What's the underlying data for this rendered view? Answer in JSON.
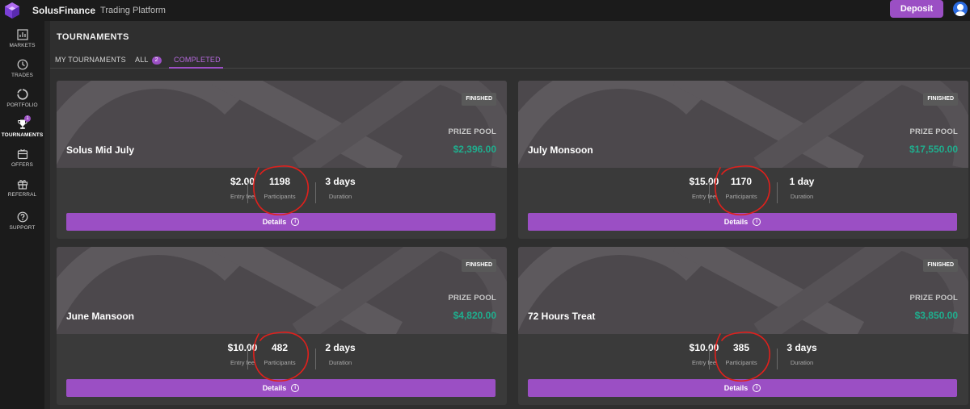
{
  "app": {
    "name": "SolusFinance",
    "subtitle": "Trading Platform",
    "deposit_label": "Deposit"
  },
  "sidebar": {
    "items": [
      {
        "label": "MARKETS",
        "icon": "chart-icon"
      },
      {
        "label": "TRADES",
        "icon": "clock-icon"
      },
      {
        "label": "PORTFOLIO",
        "icon": "portfolio-icon"
      },
      {
        "label": "TOURNAMENTS",
        "icon": "trophy-icon",
        "badge": "1"
      },
      {
        "label": "OFFERS",
        "icon": "offers-icon"
      },
      {
        "label": "REFERRAL",
        "icon": "gift-icon"
      },
      {
        "label": "SUPPORT",
        "icon": "help-icon"
      }
    ]
  },
  "page": {
    "title": "TOURNAMENTS",
    "tabs": [
      {
        "label": "MY TOURNAMENTS"
      },
      {
        "label": "ALL",
        "count": "2"
      },
      {
        "label": "COMPLETED"
      }
    ]
  },
  "labels": {
    "finished": "FINISHED",
    "prize_pool": "PRIZE POOL",
    "entry_fee": "Entry fee",
    "participants": "Participants",
    "duration": "Duration",
    "details": "Details",
    "info": "i"
  },
  "tournaments": [
    {
      "name": "Solus Mid July",
      "prize": "$2,396.00",
      "entry_fee": "$2.00",
      "participants": "1198",
      "duration": "3 days"
    },
    {
      "name": "July Monsoon",
      "prize": "$17,550.00",
      "entry_fee": "$15.00",
      "participants": "1170",
      "duration": "1 day"
    },
    {
      "name": "June Mansoon",
      "prize": "$4,820.00",
      "entry_fee": "$10.00",
      "participants": "482",
      "duration": "2 days"
    },
    {
      "name": "72 Hours Treat",
      "prize": "$3,850.00",
      "entry_fee": "$10.00",
      "participants": "385",
      "duration": "3 days"
    }
  ],
  "colors": {
    "accent": "#9b4fc4",
    "prize": "#1fae8e",
    "annotation": "#e0201c"
  }
}
